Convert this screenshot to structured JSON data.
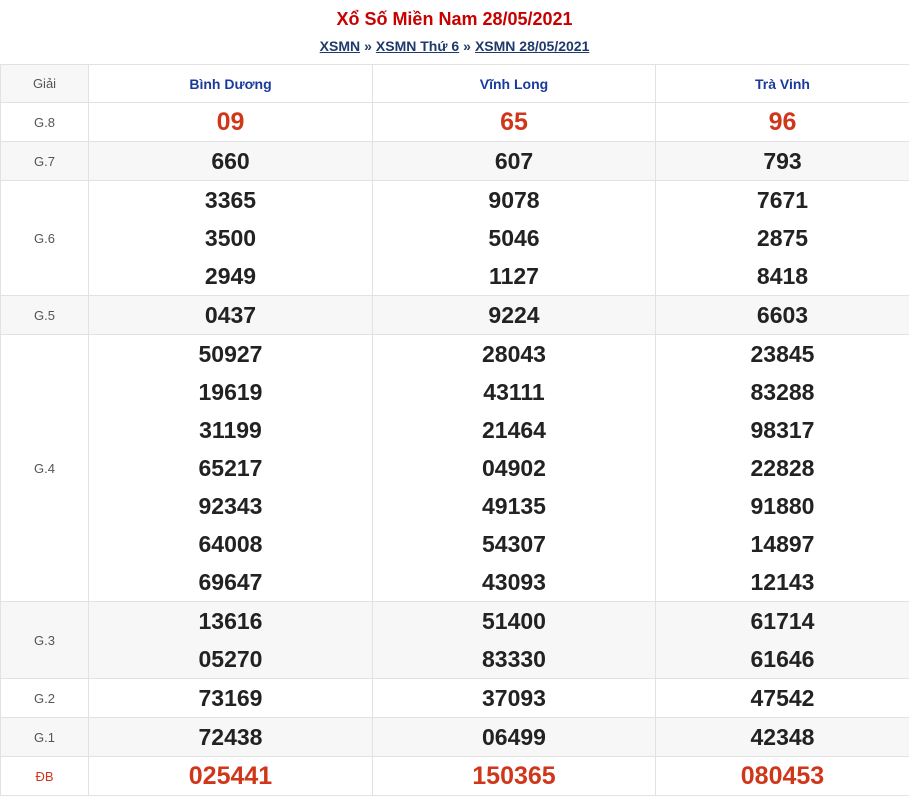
{
  "header": {
    "title": "Xổ Số Miền Nam 28/05/2021",
    "crumbs": [
      "XSMN",
      "XSMN Thứ 6",
      "XSMN 28/05/2021"
    ],
    "separator": "»"
  },
  "table": {
    "label_header": "Giải",
    "provinces": [
      "Bình Dương",
      "Vĩnh Long",
      "Trà Vinh"
    ],
    "rows": [
      {
        "label": "G.8",
        "values": [
          [
            "09"
          ],
          [
            "65"
          ],
          [
            "96"
          ]
        ]
      },
      {
        "label": "G.7",
        "values": [
          [
            "660"
          ],
          [
            "607"
          ],
          [
            "793"
          ]
        ]
      },
      {
        "label": "G.6",
        "values": [
          [
            "3365",
            "3500",
            "2949"
          ],
          [
            "9078",
            "5046",
            "1127"
          ],
          [
            "7671",
            "2875",
            "8418"
          ]
        ]
      },
      {
        "label": "G.5",
        "values": [
          [
            "0437"
          ],
          [
            "9224"
          ],
          [
            "6603"
          ]
        ]
      },
      {
        "label": "G.4",
        "values": [
          [
            "50927",
            "19619",
            "31199",
            "65217",
            "92343",
            "64008",
            "69647"
          ],
          [
            "28043",
            "43111",
            "21464",
            "04902",
            "49135",
            "54307",
            "43093"
          ],
          [
            "23845",
            "83288",
            "98317",
            "22828",
            "91880",
            "14897",
            "12143"
          ]
        ]
      },
      {
        "label": "G.3",
        "values": [
          [
            "13616",
            "05270"
          ],
          [
            "51400",
            "83330"
          ],
          [
            "61714",
            "61646"
          ]
        ]
      },
      {
        "label": "G.2",
        "values": [
          [
            "73169"
          ],
          [
            "37093"
          ],
          [
            "47542"
          ]
        ]
      },
      {
        "label": "G.1",
        "values": [
          [
            "72438"
          ],
          [
            "06499"
          ],
          [
            "42348"
          ]
        ]
      },
      {
        "label": "ĐB",
        "values": [
          [
            "025441"
          ],
          [
            "150365"
          ],
          [
            "080453"
          ]
        ]
      }
    ]
  },
  "colors": {
    "title_red": "#c80000",
    "prize_red": "#d0361a",
    "province_blue": "#1a3a9c",
    "crumb_blue": "#1f3a6a"
  }
}
